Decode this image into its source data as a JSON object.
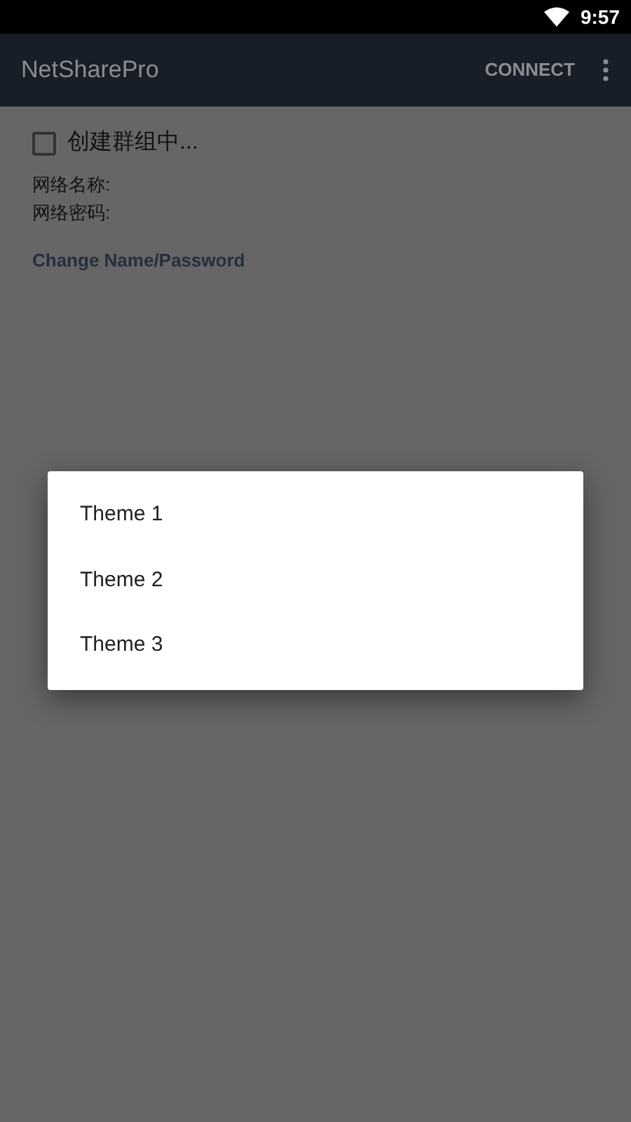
{
  "status_bar": {
    "time": "9:57"
  },
  "app_bar": {
    "title": "NetSharePro",
    "action": "CONNECT"
  },
  "group_checkbox": {
    "label": "创建群组中...",
    "checked": false
  },
  "fields": [
    {
      "label": "网络名称:"
    },
    {
      "label": "网络密码:"
    }
  ],
  "link": "Change Name/Password",
  "theme_menu": [
    {
      "label": "Theme 1"
    },
    {
      "label": "Theme 2"
    },
    {
      "label": "Theme 3"
    }
  ]
}
